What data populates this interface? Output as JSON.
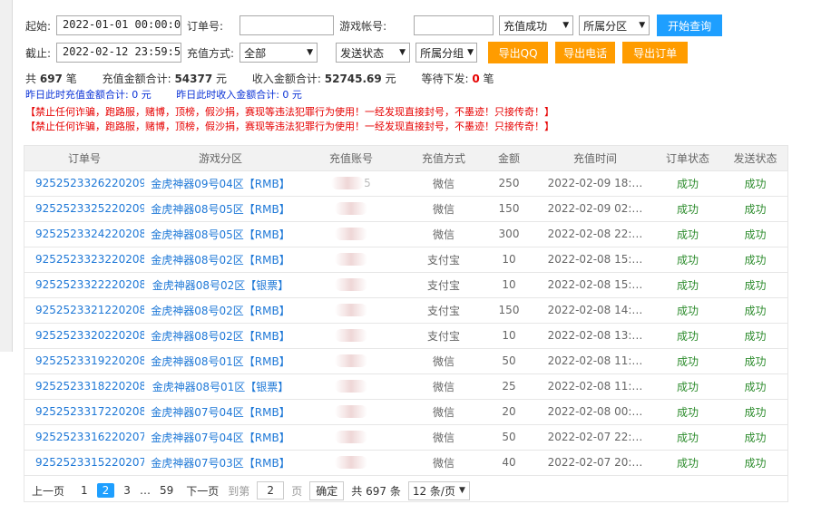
{
  "filters": {
    "start_label": "起始:",
    "start_value": "2022-01-01 00:00:0",
    "order_label": "订单号:",
    "order_value": "",
    "account_label": "游戏帐号:",
    "account_value": "",
    "status_select": "充值成功",
    "zone_select_1": "所属分区",
    "query_button": "开始查询",
    "end_label": "截止:",
    "end_value": "2022-02-12 23:59:5",
    "method_label": "充值方式:",
    "method_select": "全部",
    "send_select": "发送状态",
    "zone_select_2": "所属分组",
    "export_qq": "导出QQ",
    "export_phone": "导出电话",
    "export_order": "导出订单"
  },
  "stats": {
    "total_prefix": "共",
    "total_count": "697",
    "total_suffix": "笔",
    "recharge_label": "充值金额合计:",
    "recharge_value": "54377",
    "recharge_unit": "元",
    "income_label": "收入金额合计:",
    "income_value": "52745.69",
    "income_unit": "元",
    "pending_label": "等待下发:",
    "pending_value": "0",
    "pending_unit": "笔",
    "yesterday_recharge": "昨日此时充值金额合计: 0 元",
    "yesterday_income": "昨日此时收入金额合计: 0 元",
    "warning_1": "【禁止任何诈骗，跑路服，赌博，顶榜，假沙捐，赛现等违法犯罪行为使用！一经发现直接封号，不墨迹！只接传奇！】",
    "warning_2": "【禁止任何诈骗，跑路服，赌博，顶榜，假沙捐，赛现等违法犯罪行为使用！一经发现直接封号，不墨迹！只接传奇！】"
  },
  "table": {
    "headers": [
      "订单号",
      "游戏分区",
      "充值账号",
      "充值方式",
      "金额",
      "充值时间",
      "订单状态",
      "发送状态"
    ],
    "rows": [
      {
        "order": "9252523326220209…",
        "zone": "金虎神器09号04区【RMB】",
        "account": "5",
        "method": "微信",
        "amount": "250",
        "time": "2022-02-09 18:…",
        "status": "成功",
        "send": "成功"
      },
      {
        "order": "9252523325220209…",
        "zone": "金虎神器08号05区【RMB】",
        "account": "",
        "method": "微信",
        "amount": "150",
        "time": "2022-02-09 02:…",
        "status": "成功",
        "send": "成功"
      },
      {
        "order": "9252523324220208…",
        "zone": "金虎神器08号05区【RMB】",
        "account": "",
        "method": "微信",
        "amount": "300",
        "time": "2022-02-08 22:…",
        "status": "成功",
        "send": "成功"
      },
      {
        "order": "9252523323220208…",
        "zone": "金虎神器08号02区【RMB】",
        "account": "",
        "method": "支付宝",
        "amount": "10",
        "time": "2022-02-08 15:…",
        "status": "成功",
        "send": "成功"
      },
      {
        "order": "9252523322220208…",
        "zone": "金虎神器08号02区【银票】",
        "account": "",
        "method": "支付宝",
        "amount": "10",
        "time": "2022-02-08 15:…",
        "status": "成功",
        "send": "成功"
      },
      {
        "order": "9252523321220208…",
        "zone": "金虎神器08号02区【RMB】",
        "account": "",
        "method": "支付宝",
        "amount": "150",
        "time": "2022-02-08 14:…",
        "status": "成功",
        "send": "成功"
      },
      {
        "order": "9252523320220208…",
        "zone": "金虎神器08号02区【RMB】",
        "account": "",
        "method": "支付宝",
        "amount": "10",
        "time": "2022-02-08 13:…",
        "status": "成功",
        "send": "成功"
      },
      {
        "order": "9252523319220208…",
        "zone": "金虎神器08号01区【RMB】",
        "account": "",
        "method": "微信",
        "amount": "50",
        "time": "2022-02-08 11:…",
        "status": "成功",
        "send": "成功"
      },
      {
        "order": "9252523318220208…",
        "zone": "金虎神器08号01区【银票】",
        "account": "",
        "method": "微信",
        "amount": "25",
        "time": "2022-02-08 11:…",
        "status": "成功",
        "send": "成功"
      },
      {
        "order": "9252523317220208…",
        "zone": "金虎神器07号04区【RMB】",
        "account": "",
        "method": "微信",
        "amount": "20",
        "time": "2022-02-08 00:…",
        "status": "成功",
        "send": "成功"
      },
      {
        "order": "9252523316220207…",
        "zone": "金虎神器07号04区【RMB】",
        "account": "",
        "method": "微信",
        "amount": "50",
        "time": "2022-02-07 22:…",
        "status": "成功",
        "send": "成功"
      },
      {
        "order": "9252523315220207…",
        "zone": "金虎神器07号03区【RMB】",
        "account": "",
        "method": "微信",
        "amount": "40",
        "time": "2022-02-07 20:…",
        "status": "成功",
        "send": "成功"
      }
    ]
  },
  "pager": {
    "prev": "上一页",
    "pages": [
      "1",
      "2",
      "3",
      "…",
      "59"
    ],
    "current": "2",
    "next": "下一页",
    "goto_label": "到第",
    "goto_value": "2",
    "page_unit": "页",
    "confirm": "确定",
    "total": "共 697 条",
    "per_page": "12 条/页"
  }
}
